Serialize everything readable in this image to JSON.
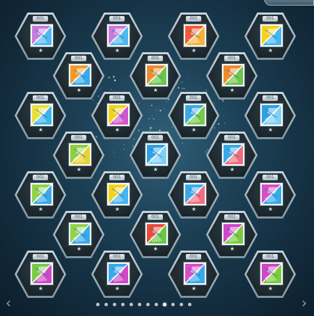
{
  "colors": {
    "accent": "#1ea7e8",
    "bg_dark": "#132c3d"
  },
  "grid": {
    "rows": [
      {
        "items": [
          {
            "code": "001",
            "star": "★",
            "scheme": "purple-blue"
          },
          {
            "code": "001",
            "star": "★",
            "scheme": "purple-blue"
          },
          {
            "code": "001",
            "star": "★",
            "scheme": "red-orange"
          },
          {
            "code": "001",
            "star": "★",
            "scheme": "yellow-blue"
          }
        ]
      },
      {
        "items": [
          {
            "code": "001",
            "star": "★",
            "scheme": "orange-blue"
          },
          {
            "code": "001",
            "star": "★",
            "scheme": "orange-green"
          },
          {
            "code": "001",
            "star": "★",
            "scheme": "orange-green"
          }
        ]
      },
      {
        "items": [
          {
            "code": "001",
            "star": "★",
            "scheme": "yellow-green"
          },
          {
            "code": "001",
            "star": "★",
            "scheme": "yellow-magenta"
          },
          {
            "code": "001",
            "star": "★",
            "scheme": "blue-green"
          },
          {
            "code": "001",
            "star": "★",
            "scheme": "blue-blue"
          }
        ]
      },
      {
        "items": [
          {
            "code": "001",
            "star": "★",
            "scheme": "green-yellow"
          },
          {
            "code": "001",
            "star": "★",
            "scheme": "blue-blue"
          },
          {
            "code": "001",
            "star": "★",
            "scheme": "blue-red"
          }
        ]
      },
      {
        "items": [
          {
            "code": "001",
            "star": "★",
            "scheme": "green-blue"
          },
          {
            "code": "001",
            "star": "★",
            "scheme": "yellow-blue"
          },
          {
            "code": "001",
            "star": "★",
            "scheme": "blue-red"
          },
          {
            "code": "001",
            "star": "★",
            "scheme": "magenta-blue"
          }
        ]
      },
      {
        "items": [
          {
            "code": "001",
            "star": "★",
            "scheme": "green-blue"
          },
          {
            "code": "001",
            "star": "★",
            "scheme": "red-green"
          },
          {
            "code": "001",
            "star": "★",
            "scheme": "magenta-green"
          }
        ]
      },
      {
        "items": [
          {
            "code": "001",
            "star": "★",
            "scheme": "green-magenta"
          },
          {
            "code": "001",
            "star": "★",
            "scheme": "blue-magenta"
          },
          {
            "code": "001",
            "star": "★",
            "scheme": "magenta-blue"
          },
          {
            "code": "001",
            "star": "★",
            "scheme": "magenta-green"
          }
        ]
      }
    ]
  },
  "pager": {
    "prev_icon": "chevron-left-icon",
    "next_icon": "chevron-right-icon",
    "prev_glyph": "‹",
    "next_glyph": "›",
    "page_count": 12,
    "active_page": 9
  },
  "schemes": {
    "purple-blue": [
      "#c77bdc",
      "#4fb8f0"
    ],
    "red-orange": [
      "#f25b3b",
      "#f6b23a"
    ],
    "yellow-blue": [
      "#f3d21b",
      "#47b5ee"
    ],
    "orange-blue": [
      "#f39a26",
      "#3aa8ea"
    ],
    "orange-green": [
      "#f08a2d",
      "#6cc64a"
    ],
    "yellow-green": [
      "#e9e03c",
      "#39b6ea"
    ],
    "yellow-magenta": [
      "#f0d31d",
      "#d257c9"
    ],
    "blue-green": [
      "#3aa9e8",
      "#78c94e"
    ],
    "blue-blue": [
      "#2ea0e3",
      "#7fd0f5"
    ],
    "green-yellow": [
      "#8ccf3f",
      "#e6d236"
    ],
    "blue-red": [
      "#3aa9e8",
      "#f06d7e"
    ],
    "green-blue": [
      "#8fd24c",
      "#3aa9e8"
    ],
    "magenta-blue": [
      "#d64fc7",
      "#3aa9e8"
    ],
    "red-green": [
      "#ea4b3a",
      "#6cc64a"
    ],
    "magenta-green": [
      "#cf48c6",
      "#7bcb3f"
    ],
    "green-magenta": [
      "#7cc94a",
      "#cf48c6"
    ],
    "blue-magenta": [
      "#3aa9e8",
      "#cf48c6"
    ]
  }
}
